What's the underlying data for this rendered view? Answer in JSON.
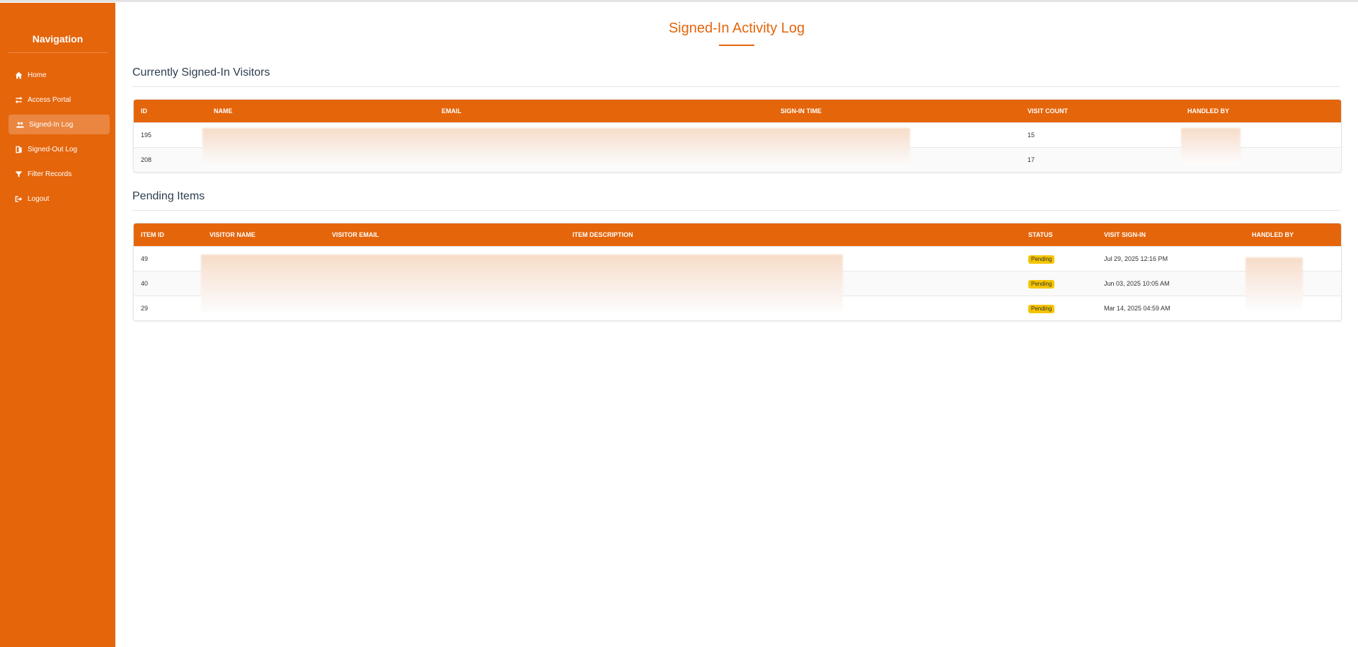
{
  "sidebar": {
    "title": "Navigation",
    "items": [
      {
        "label": "Home",
        "icon": "home-icon",
        "active": false
      },
      {
        "label": "Access Portal",
        "icon": "exchange-icon",
        "active": false
      },
      {
        "label": "Signed-In Log",
        "icon": "users-icon",
        "active": true
      },
      {
        "label": "Signed-Out Log",
        "icon": "door-icon",
        "active": false
      },
      {
        "label": "Filter Records",
        "icon": "filter-icon",
        "active": false
      },
      {
        "label": "Logout",
        "icon": "logout-icon",
        "active": false
      }
    ]
  },
  "page": {
    "title": "Signed-In Activity Log",
    "accent_color": "#e5650b"
  },
  "signed_in": {
    "title": "Currently Signed-In Visitors",
    "headers": [
      "ID",
      "NAME",
      "EMAIL",
      "SIGN-IN TIME",
      "VISIT COUNT",
      "HANDLED BY"
    ],
    "rows": [
      {
        "id": "195",
        "visit_count": "15"
      },
      {
        "id": "208",
        "visit_count": "17"
      }
    ]
  },
  "pending": {
    "title": "Pending Items",
    "headers": [
      "ITEM ID",
      "VISITOR NAME",
      "VISITOR EMAIL",
      "ITEM DESCRIPTION",
      "STATUS",
      "VISIT SIGN-IN",
      "HANDLED BY"
    ],
    "status_color": "#f5c400",
    "rows": [
      {
        "item_id": "49",
        "status": "Pending",
        "visit_sign_in": "Jul 29, 2025 12:16 PM"
      },
      {
        "item_id": "40",
        "status": "Pending",
        "visit_sign_in": "Jun 03, 2025 10:05 AM"
      },
      {
        "item_id": "29",
        "status": "Pending",
        "visit_sign_in": "Mar 14, 2025 04:59 AM"
      }
    ]
  }
}
